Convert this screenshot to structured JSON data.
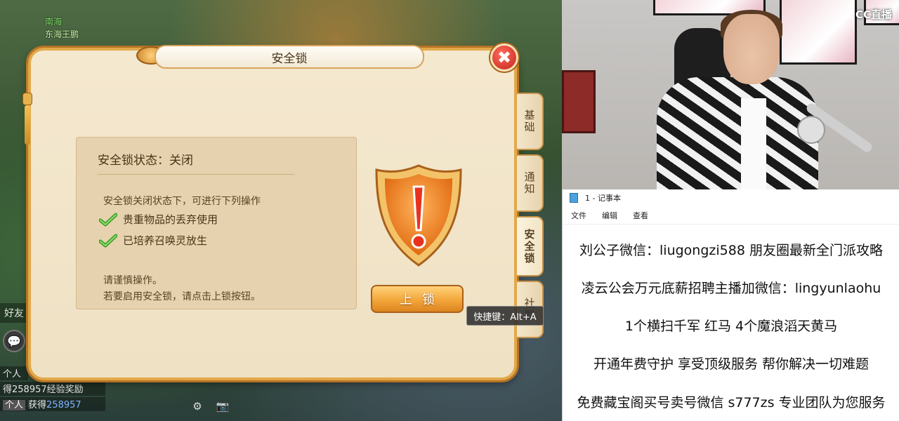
{
  "game": {
    "top_name": "南海",
    "top_sub": "东海王鹏",
    "dialog": {
      "title": "安全锁",
      "close_symbol": "✖",
      "tabs": [
        "基础",
        "通知",
        "安全锁",
        "社群"
      ],
      "status_title": "安全锁状态：关闭",
      "description": "安全锁关闭状态下，可进行下列操作",
      "allowed_actions": [
        "贵重物品的丢弃使用",
        "已培养召唤灵放生"
      ],
      "note_line1": "请谨慎操作。",
      "note_line2": "若要启用安全锁，请点击上锁按钮。",
      "lock_button": "上锁",
      "tooltip": "快捷键：Alt+A"
    },
    "chat": {
      "friends_label": "好友",
      "lines": [
        {
          "tag": "个人",
          "text": "",
          "num": ""
        },
        {
          "tag": "",
          "text": "得258957经验奖励",
          "num": ""
        },
        {
          "tag": "个人",
          "text": "获得",
          "num": "258957"
        }
      ]
    },
    "colors": {
      "accent": "#e2a84a",
      "button": "#f3a63a",
      "close": "#c4261c"
    }
  },
  "webcam": {
    "logo": "CC直播"
  },
  "notepad": {
    "title": "1 - 记事本",
    "menu": [
      "文件",
      "编辑",
      "查看"
    ],
    "lines": [
      "刘公子微信：liugongzi588 朋友圈最新全门派攻略",
      "凌云公会万元底薪招聘主播加微信：lingyunlaohu",
      "1个横扫千军 红马    4个魔浪滔天黄马",
      "开通年费守护 享受顶级服务 帮你解决一切难题",
      "免费藏宝阁买号卖号微信 s777zs 专业团队为您服务"
    ]
  }
}
